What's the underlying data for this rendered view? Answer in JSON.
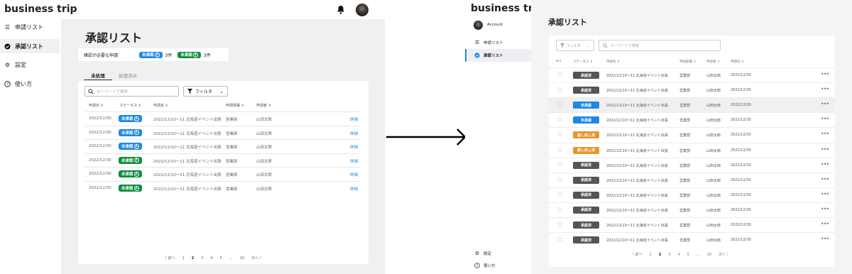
{
  "left_app": {
    "brand": "business trip",
    "nav": [
      {
        "label": "申請リスト",
        "icon": "list-icon"
      },
      {
        "label": "承認リスト",
        "icon": "check-circle-icon"
      },
      {
        "label": "設定",
        "icon": "gear-icon"
      },
      {
        "label": "使い方",
        "icon": "help-icon"
      }
    ],
    "page_title": "承認リスト",
    "summary": {
      "label": "確認が必要な申請",
      "badge1": "未承認",
      "badge1_num": "1",
      "count1": "3件",
      "badge2": "未承認",
      "badge2_num": "2",
      "count2": "3件"
    },
    "tabs": [
      "未処理",
      "処理済み"
    ],
    "search_placeholder": "キーワードで検索",
    "filter_label": "フィルタ",
    "columns": [
      "申請日",
      "ステータス",
      "申請名",
      "申請部署",
      "申請者"
    ],
    "rows": [
      {
        "date": "2022/12/30",
        "status": "未承認",
        "num": "1",
        "color": "#1e88e5",
        "name": "2022/12/10〜11 北海道イベント出張",
        "dept": "営業部",
        "user": "山田太郎",
        "detail": "詳細"
      },
      {
        "date": "2022/12/30",
        "status": "未承認",
        "num": "1",
        "color": "#1e88e5",
        "name": "2022/12/10〜11 北海道イベント出張",
        "dept": "営業部",
        "user": "山田太郎",
        "detail": "詳細"
      },
      {
        "date": "2022/12/30",
        "status": "未承認",
        "num": "1",
        "color": "#1e88e5",
        "name": "2022/12/10〜11 北海道イベント出張",
        "dept": "営業部",
        "user": "山田太郎",
        "detail": "詳細"
      },
      {
        "date": "2022/12/30",
        "status": "未承認",
        "num": "2",
        "color": "#0d8f3c",
        "name": "2022/12/10〜11 北海道イベント出張",
        "dept": "営業部",
        "user": "山田太郎",
        "detail": "詳細"
      },
      {
        "date": "2022/12/30",
        "status": "未承認",
        "num": "2",
        "color": "#0d8f3c",
        "name": "2022/12/10〜11 北海道イベント出張",
        "dept": "営業部",
        "user": "山田太郎",
        "detail": "詳細"
      },
      {
        "date": "2022/12/30",
        "status": "未承認",
        "num": "2",
        "color": "#0d8f3c",
        "name": "2022/12/10〜11 北海道イベント出張",
        "dept": "営業部",
        "user": "山田太郎",
        "detail": "詳細"
      }
    ],
    "pager": [
      "〈 前へ",
      "1",
      "2",
      "3",
      "4",
      "5",
      "...",
      "10",
      "次へ 〉"
    ]
  },
  "right_app": {
    "brand": "business trip",
    "account": "Account",
    "nav": [
      {
        "label": "申請リスト",
        "icon": "list-icon"
      },
      {
        "label": "承認リスト",
        "icon": "check-circle-icon"
      }
    ],
    "bottom_nav": [
      {
        "label": "設定",
        "icon": "gear-icon"
      },
      {
        "label": "使い方",
        "icon": "help-icon"
      }
    ],
    "page_title": "承認リスト",
    "filter_label": "フィルタ",
    "search_placeholder": "キーワードで検索",
    "columns": [
      "★",
      "ステータス",
      "申請名",
      "申請部署",
      "申請者",
      "申請日"
    ],
    "rows": [
      {
        "status": "承認済",
        "color": "#555555",
        "name": "2022/12/10〜11 北海道イベント出張",
        "dept": "営業部",
        "user": "山田太郎",
        "date": "2022/12/30"
      },
      {
        "status": "承認済",
        "color": "#555555",
        "name": "2022/12/10〜11 北海道イベント出張",
        "dept": "営業部",
        "user": "山田太郎",
        "date": "2022/12/30"
      },
      {
        "status": "未承認",
        "color": "#1e88e5",
        "name": "2022/12/10〜11 北海道イベント出張",
        "dept": "営業部",
        "user": "山田太郎",
        "date": "2022/12/30"
      },
      {
        "status": "未承認",
        "color": "#1e88e5",
        "name": "2022/12/10〜11 北海道イベント出張",
        "dept": "営業部",
        "user": "山田太郎",
        "date": "2022/12/30"
      },
      {
        "status": "差し戻し済",
        "color": "#e8962c",
        "name": "2022/12/10〜11 北海道イベント出張",
        "dept": "営業部",
        "user": "山田太郎",
        "date": "2022/12/30"
      },
      {
        "status": "差し戻し済",
        "color": "#e8962c",
        "name": "2022/12/10〜11 北海道イベント出張",
        "dept": "営業部",
        "user": "山田太郎",
        "date": "2022/12/30"
      },
      {
        "status": "承認済",
        "color": "#555555",
        "name": "2022/12/10〜11 北海道イベント出張",
        "dept": "営業部",
        "user": "山田太郎",
        "date": "2022/12/30"
      },
      {
        "status": "承認済",
        "color": "#555555",
        "name": "2022/12/10〜11 北海道イベント出張",
        "dept": "営業部",
        "user": "山田太郎",
        "date": "2022/12/30"
      },
      {
        "status": "承認済",
        "color": "#555555",
        "name": "2022/12/10〜11 北海道イベント出張",
        "dept": "営業部",
        "user": "山田太郎",
        "date": "2022/12/30"
      },
      {
        "status": "承認済",
        "color": "#555555",
        "name": "2022/12/10〜11 北海道イベント出張",
        "dept": "営業部",
        "user": "山田太郎",
        "date": "2022/12/30"
      },
      {
        "status": "承認済",
        "color": "#555555",
        "name": "2022/12/10〜11 北海道イベント出張",
        "dept": "営業部",
        "user": "山田太郎",
        "date": "2022/12/30"
      },
      {
        "status": "承認済",
        "color": "#555555",
        "name": "2022/12/10〜11 北海道イベント出張",
        "dept": "営業部",
        "user": "山田太郎",
        "date": "2022/12/30"
      }
    ],
    "more": "•••",
    "pager": [
      "〈 前へ",
      "1",
      "2",
      "3",
      "4",
      "5",
      "...",
      "10",
      "次へ 〉"
    ]
  }
}
